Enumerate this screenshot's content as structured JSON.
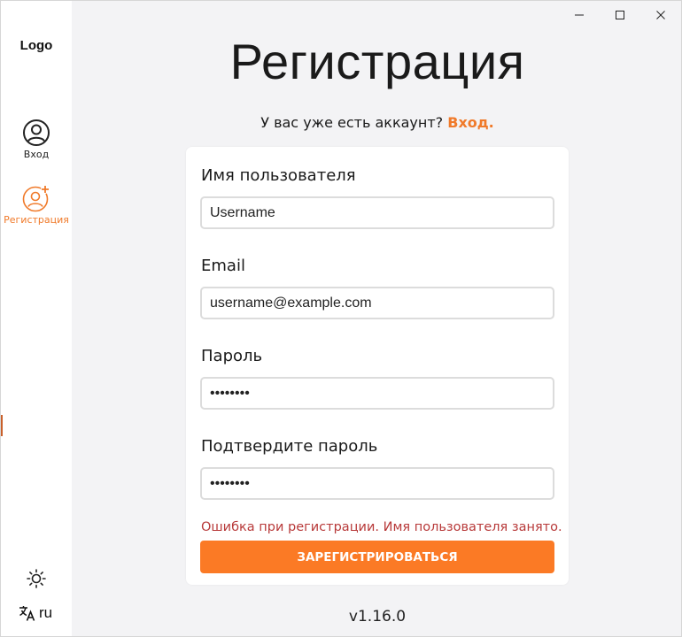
{
  "sidebar": {
    "logo": "Logo",
    "items": [
      {
        "label": "Вход",
        "icon": "user-circle-icon"
      },
      {
        "label": "Регистрация",
        "icon": "user-add-icon",
        "active": true
      }
    ],
    "theme_icon": "sun-icon",
    "language_icon": "translate-icon",
    "language": "ru"
  },
  "main": {
    "title": "Регистрация",
    "login_prompt": "У вас уже есть аккаунт?",
    "login_link": "Вход.",
    "fields": [
      {
        "label": "Имя пользователя",
        "value": "Username",
        "type": "text"
      },
      {
        "label": "Email",
        "value": "username@example.com",
        "type": "email"
      },
      {
        "label": "Пароль",
        "value": "••••••••",
        "type": "password"
      },
      {
        "label": "Подтвердите пароль",
        "value": "••••••••",
        "type": "password"
      }
    ],
    "error": "Ошибка при регистрации. Имя пользователя занято.",
    "submit_label": "ЗАРЕГИСТРИРОВАТЬСЯ",
    "version": "v1.16.0"
  },
  "colors": {
    "accent": "#fb7a25",
    "accent_text": "#f07a2a",
    "error": "#b83a3a",
    "background": "#f3f3f5"
  }
}
